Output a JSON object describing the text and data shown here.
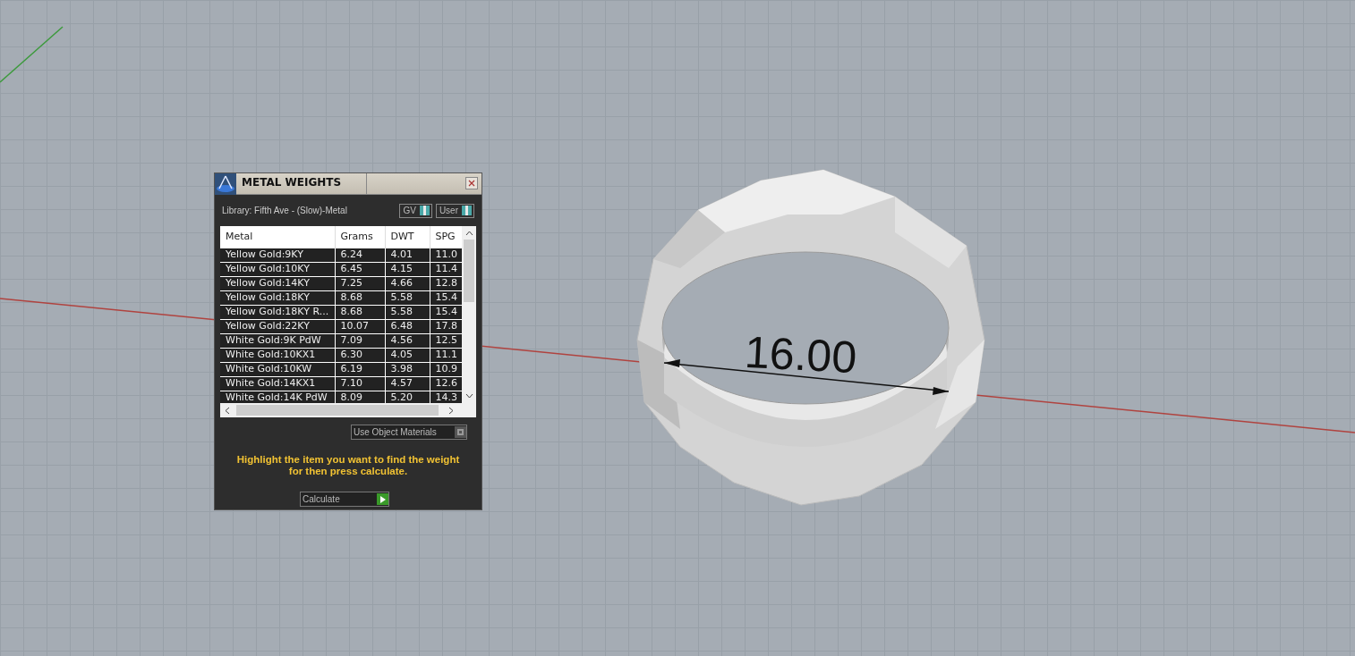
{
  "dialog": {
    "title": "METAL WEIGHTS",
    "library": "Library: Fifth Ave - (Slow)-Metal",
    "toggles": [
      {
        "label": "GV",
        "on": true
      },
      {
        "label": "User",
        "on": true
      }
    ],
    "table": {
      "columns": [
        "Metal",
        "Grams",
        "DWT",
        "SPG"
      ],
      "rows": [
        [
          "Yellow Gold:9KY",
          "6.24",
          "4.01",
          "11.0"
        ],
        [
          "Yellow Gold:10KY",
          "6.45",
          "4.15",
          "11.4"
        ],
        [
          "Yellow Gold:14KY",
          "7.25",
          "4.66",
          "12.8"
        ],
        [
          "Yellow Gold:18KY",
          "8.68",
          "5.58",
          "15.4"
        ],
        [
          "Yellow Gold:18KY R...",
          "8.68",
          "5.58",
          "15.4"
        ],
        [
          "Yellow Gold:22KY",
          "10.07",
          "6.48",
          "17.8"
        ],
        [
          "White Gold:9K PdW",
          "7.09",
          "4.56",
          "12.5"
        ],
        [
          "White Gold:10KX1",
          "6.30",
          "4.05",
          "11.1"
        ],
        [
          "White Gold:10KW",
          "6.19",
          "3.98",
          "10.9"
        ],
        [
          "White Gold:14KX1",
          "7.10",
          "4.57",
          "12.6"
        ],
        [
          "White Gold:14K PdW",
          "8.09",
          "5.20",
          "14.3"
        ]
      ]
    },
    "use_object_materials": {
      "label": "Use Object Materials",
      "on": false
    },
    "hint": "Highlight the item you want to find the weight for then press calculate.",
    "calculate_button": "Calculate"
  },
  "viewport": {
    "dimension": "16.00"
  }
}
